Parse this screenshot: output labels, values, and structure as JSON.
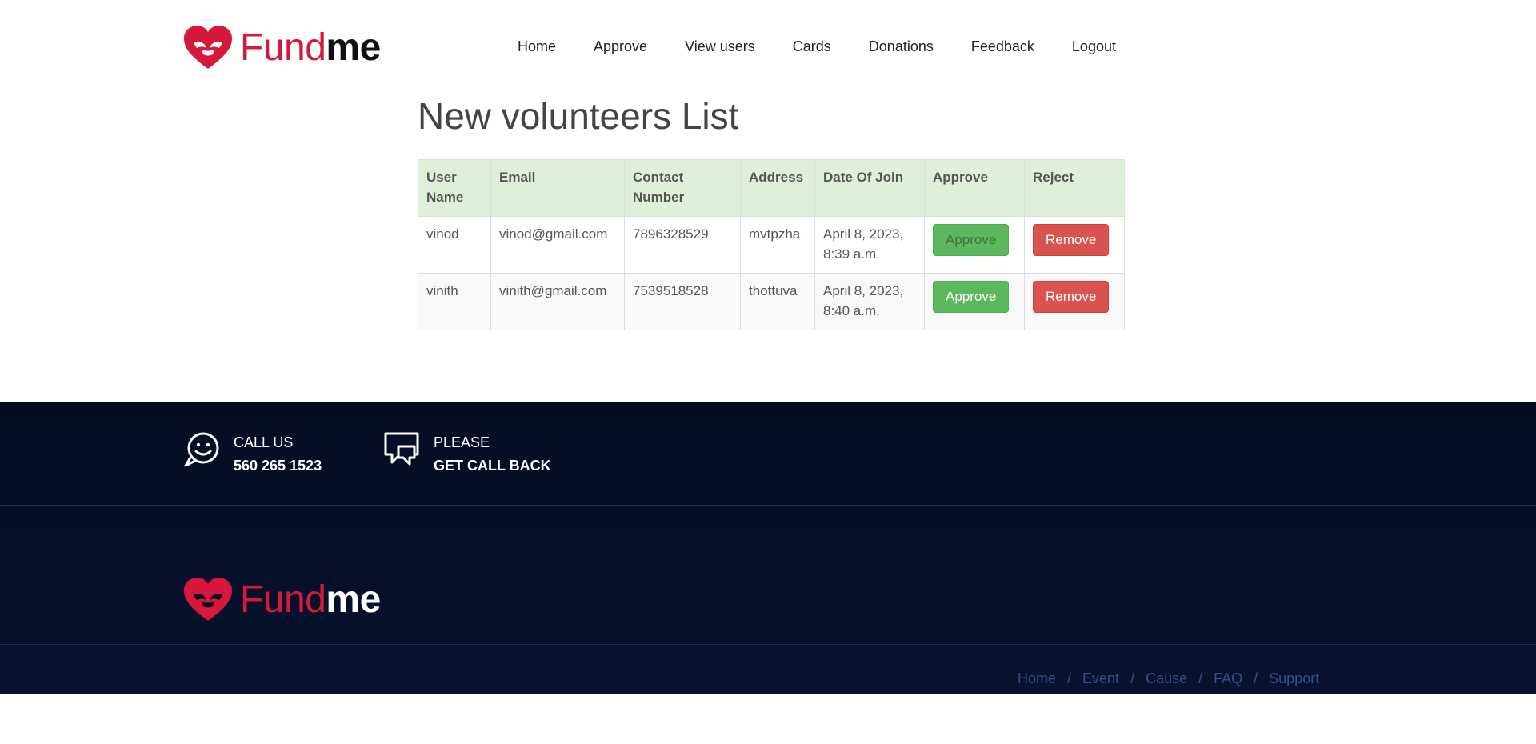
{
  "brand": {
    "name_part1": "Fund",
    "name_part2": "me",
    "accent": "#d6193a"
  },
  "nav": {
    "items": [
      "Home",
      "Approve",
      "View users",
      "Cards",
      "Donations",
      "Feedback",
      "Logout"
    ]
  },
  "page": {
    "title": "New volunteers List"
  },
  "table": {
    "headers": [
      "User Name",
      "Email",
      "Contact Number",
      "Address",
      "Date Of Join",
      "Approve",
      "Reject"
    ],
    "rows": [
      {
        "user": "vinod",
        "email": "vinod@gmail.com",
        "contact": "7896328529",
        "address": "mvtpzha",
        "date": "April 8, 2023, 8:39 a.m.",
        "approve": "Approve",
        "reject": "Remove"
      },
      {
        "user": "vinith",
        "email": "vinith@gmail.com",
        "contact": "7539518528",
        "address": "thottuva",
        "date": "April 8, 2023, 8:40 a.m.",
        "approve": "Approve",
        "reject": "Remove"
      }
    ]
  },
  "footer": {
    "call": {
      "line1": "CALL US",
      "line2": "560 265 1523"
    },
    "callback": {
      "line1": "PLEASE",
      "line2": "GET CALL BACK"
    },
    "links": [
      "Home",
      "Event",
      "Cause",
      "FAQ",
      "Support"
    ]
  },
  "colors": {
    "approve": "#5cb85c",
    "remove": "#d9534f",
    "header_bg": "#dff0d8",
    "footer_bg": "#050d24"
  }
}
